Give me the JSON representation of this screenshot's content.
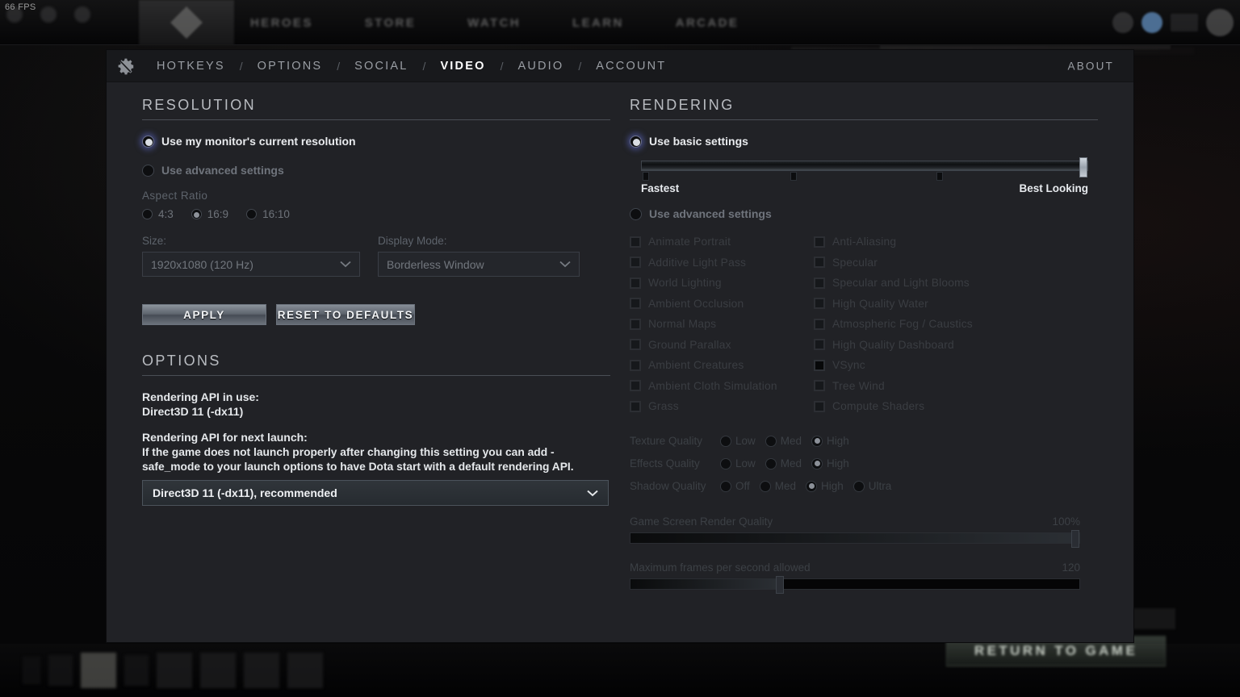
{
  "hud": {
    "fps": "66 FPS",
    "nav_items": [
      "HEROES",
      "STORE",
      "WATCH",
      "LEARN",
      "ARCADE"
    ],
    "return_to_game": "RETURN TO GAME"
  },
  "header": {
    "gear_icon": "gear-icon",
    "tabs": [
      {
        "label": "HOTKEYS",
        "active": false
      },
      {
        "label": "OPTIONS",
        "active": false
      },
      {
        "label": "SOCIAL",
        "active": false
      },
      {
        "label": "VIDEO",
        "active": true
      },
      {
        "label": "AUDIO",
        "active": false
      },
      {
        "label": "ACCOUNT",
        "active": false
      }
    ],
    "separator": "/",
    "about": "ABOUT"
  },
  "resolution": {
    "title": "RESOLUTION",
    "use_monitor_label": "Use my monitor's current resolution",
    "use_monitor_selected": true,
    "use_advanced_label": "Use advanced settings",
    "use_advanced_selected": false,
    "aspect_ratio_label": "Aspect Ratio",
    "aspect_ratios": [
      {
        "label": "4:3",
        "selected": false
      },
      {
        "label": "16:9",
        "selected": true
      },
      {
        "label": "16:10",
        "selected": false
      }
    ],
    "size_label": "Size:",
    "size_value": "1920x1080 (120 Hz)",
    "display_mode_label": "Display Mode:",
    "display_mode_value": "Borderless Window",
    "apply_label": "APPLY",
    "reset_label": "RESET TO DEFAULTS"
  },
  "options": {
    "title": "OPTIONS",
    "api_in_use_label": "Rendering API in use:",
    "api_in_use_value": "Direct3D 11 (-dx11)",
    "api_next_label": "Rendering API for next launch:",
    "api_help_text": "If the game does not launch properly after changing this setting you can add -safe_mode to your launch options to have Dota start with a default rendering API.",
    "api_select_value": "Direct3D 11 (-dx11), recommended"
  },
  "rendering": {
    "title": "RENDERING",
    "use_basic_label": "Use basic settings",
    "use_basic_selected": true,
    "use_advanced_label": "Use advanced settings",
    "use_advanced_selected": false,
    "quality_slider": {
      "min_label": "Fastest",
      "max_label": "Best Looking",
      "value_percent": 100
    },
    "checkboxes_left": [
      {
        "label": "Animate Portrait",
        "checked": false
      },
      {
        "label": "Additive Light Pass",
        "checked": false
      },
      {
        "label": "World Lighting",
        "checked": false
      },
      {
        "label": "Ambient Occlusion",
        "checked": false
      },
      {
        "label": "Normal Maps",
        "checked": false
      },
      {
        "label": "Ground Parallax",
        "checked": false
      },
      {
        "label": "Ambient Creatures",
        "checked": false
      },
      {
        "label": "Ambient Cloth Simulation",
        "checked": false
      },
      {
        "label": "Grass",
        "checked": false
      }
    ],
    "checkboxes_right": [
      {
        "label": "Anti-Aliasing",
        "checked": false
      },
      {
        "label": "Specular",
        "checked": false
      },
      {
        "label": "Specular and Light Blooms",
        "checked": false
      },
      {
        "label": "High Quality Water",
        "checked": false
      },
      {
        "label": "Atmospheric Fog / Caustics",
        "checked": false
      },
      {
        "label": "High Quality Dashboard",
        "checked": false
      },
      {
        "label": "VSync",
        "checked": true
      },
      {
        "label": "Tree Wind",
        "checked": false
      },
      {
        "label": "Compute Shaders",
        "checked": false
      }
    ],
    "quality_rows": [
      {
        "name": "Texture Quality",
        "options": [
          {
            "label": "Low",
            "selected": false
          },
          {
            "label": "Med",
            "selected": false
          },
          {
            "label": "High",
            "selected": true
          }
        ]
      },
      {
        "name": "Effects Quality",
        "options": [
          {
            "label": "Low",
            "selected": false
          },
          {
            "label": "Med",
            "selected": false
          },
          {
            "label": "High",
            "selected": true
          }
        ]
      },
      {
        "name": "Shadow Quality",
        "options": [
          {
            "label": "Off",
            "selected": false
          },
          {
            "label": "Med",
            "selected": false
          },
          {
            "label": "High",
            "selected": true
          },
          {
            "label": "Ultra",
            "selected": false
          }
        ]
      }
    ],
    "render_quality": {
      "label": "Game Screen Render Quality",
      "value": "100%",
      "percent": 100
    },
    "max_fps": {
      "label": "Maximum frames per second allowed",
      "value": "120",
      "percent": 33
    }
  },
  "colors": {
    "panel_bg": "#212226",
    "header_bg": "#18191c",
    "accent_glow": "#5a64be",
    "active_tab": "#ffffff",
    "dim_text": "#3c4045"
  }
}
